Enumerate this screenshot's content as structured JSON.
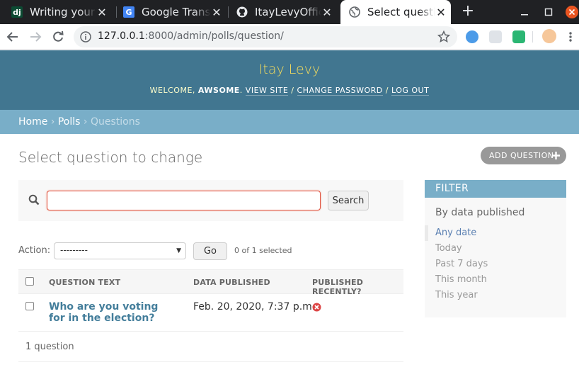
{
  "browser": {
    "tabs": [
      {
        "favicon": "dj",
        "title": "Writing your first Django app"
      },
      {
        "favicon": "G",
        "title": "Google Translate"
      },
      {
        "favicon": "github",
        "title": "ItayLevyOfficial"
      },
      {
        "favicon": "globe",
        "title": "Select question to change"
      }
    ],
    "url_host": "127.0.0.1",
    "url_rest": ":8000/admin/polls/question/"
  },
  "site": {
    "branding": "Itay Levy",
    "welcome": "WELCOME,",
    "user": "AWSOME",
    "view_site": "VIEW SITE",
    "change_password": "CHANGE PASSWORD",
    "log_out": "LOG OUT",
    "sep": "/"
  },
  "breadcrumbs": {
    "home": "Home",
    "polls": "Polls",
    "current": "Questions",
    "sep": "›"
  },
  "page": {
    "title": "Select question to change",
    "add_button": "ADD QUESTION"
  },
  "search": {
    "button": "Search",
    "value": ""
  },
  "actions": {
    "label": "Action:",
    "selected_option": "---------",
    "go": "Go",
    "counter": "0 of 1 selected"
  },
  "table": {
    "headers": [
      "QUESTION TEXT",
      "DATA PUBLISHED",
      "PUBLISHED RECENTLY?"
    ],
    "rows": [
      {
        "question": "Who are you voting for in the election?",
        "published": "Feb. 20, 2020, 7:37 p.m.",
        "recent": false
      }
    ],
    "paginator": "1 question"
  },
  "filter": {
    "title": "FILTER",
    "subtitle": "By data published",
    "options": [
      "Any date",
      "Today",
      "Past 7 days",
      "This month",
      "This year"
    ]
  },
  "colors": {
    "header": "#417690",
    "breadcrumbs": "#79aec8",
    "link": "#447e9b",
    "branding": "#f5dd5d"
  }
}
